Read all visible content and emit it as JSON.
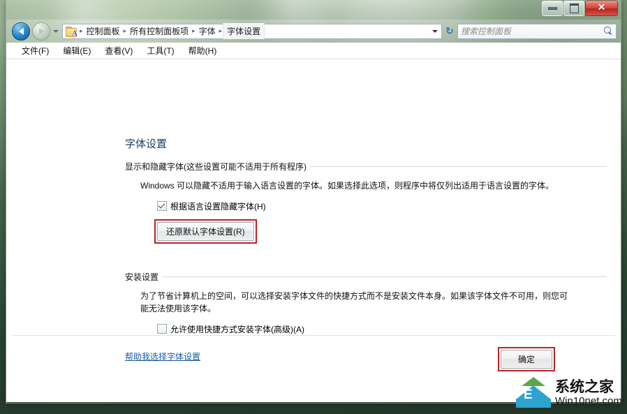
{
  "window": {
    "controls": {
      "minimize_label": "最小化",
      "maximize_label": "最大化",
      "close_label": "✕"
    }
  },
  "nav": {
    "back_label": "后退",
    "forward_label": "前进",
    "history_label": "最近访问的位置",
    "refresh_label": "刷新",
    "breadcrumbs": [
      {
        "label": "控制面板"
      },
      {
        "label": "所有控制面板项"
      },
      {
        "label": "字体"
      },
      {
        "label": "字体设置"
      }
    ],
    "separator": "▸"
  },
  "search": {
    "placeholder": "搜索控制面板",
    "value": ""
  },
  "menubar": {
    "items": [
      {
        "label": "文件(F)"
      },
      {
        "label": "编辑(E)"
      },
      {
        "label": "查看(V)"
      },
      {
        "label": "工具(T)"
      },
      {
        "label": "帮助(H)"
      }
    ]
  },
  "main": {
    "page_title": "字体设置",
    "display_group": {
      "label": "显示和隐藏字体(这些设置可能不适用于所有程序)",
      "description": "Windows 可以隐藏不适用于输入语言设置的字体。如果选择此选项，则程序中将仅列出适用于语言设置的字体。",
      "checkbox_label": "根据语言设置隐藏字体(H)",
      "checkbox_checked": true,
      "restore_button_label": "还原默认字体设置(R)"
    },
    "install_group": {
      "label": "安装设置",
      "description": "为了节省计算机上的空间，可以选择安装字体文件的快捷方式而不是安装文件本身。如果该字体文件不可用，则您可能无法使用该字体。",
      "checkbox_label": "允许使用快捷方式安装字体(高级)(A)",
      "checkbox_checked": false
    },
    "help_link_label": "帮助我选择字体设置",
    "ok_button_label": "确定"
  },
  "watermark": {
    "cn": "系统之家",
    "en": "Win10net.com",
    "logo_letter": "E"
  },
  "colors": {
    "highlight_red": "#bf2026",
    "title_blue": "#1f3c63",
    "link_blue": "#1a5ca8",
    "close_red": "#d9483f"
  }
}
